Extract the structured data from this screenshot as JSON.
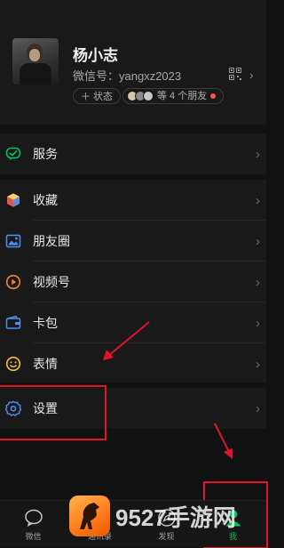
{
  "profile": {
    "name": "杨小志",
    "wechat_id": "微信号：yangxz2023",
    "status_label": "＋ 状态",
    "friends_label": "等 4 个朋友"
  },
  "menu": {
    "service": "服务",
    "favorites": "收藏",
    "moments": "朋友圈",
    "channels": "视频号",
    "cards": "卡包",
    "stickers": "表情",
    "settings": "设置"
  },
  "tabs": [
    {
      "label": "微信"
    },
    {
      "label": "通讯录"
    },
    {
      "label": "发现"
    },
    {
      "label": "我"
    }
  ],
  "watermark": {
    "text": "9527手游网"
  },
  "colors": {
    "accent_green": "#07c160",
    "annotation_red": "#e2142d",
    "background": "#111111",
    "card": "#191919"
  }
}
